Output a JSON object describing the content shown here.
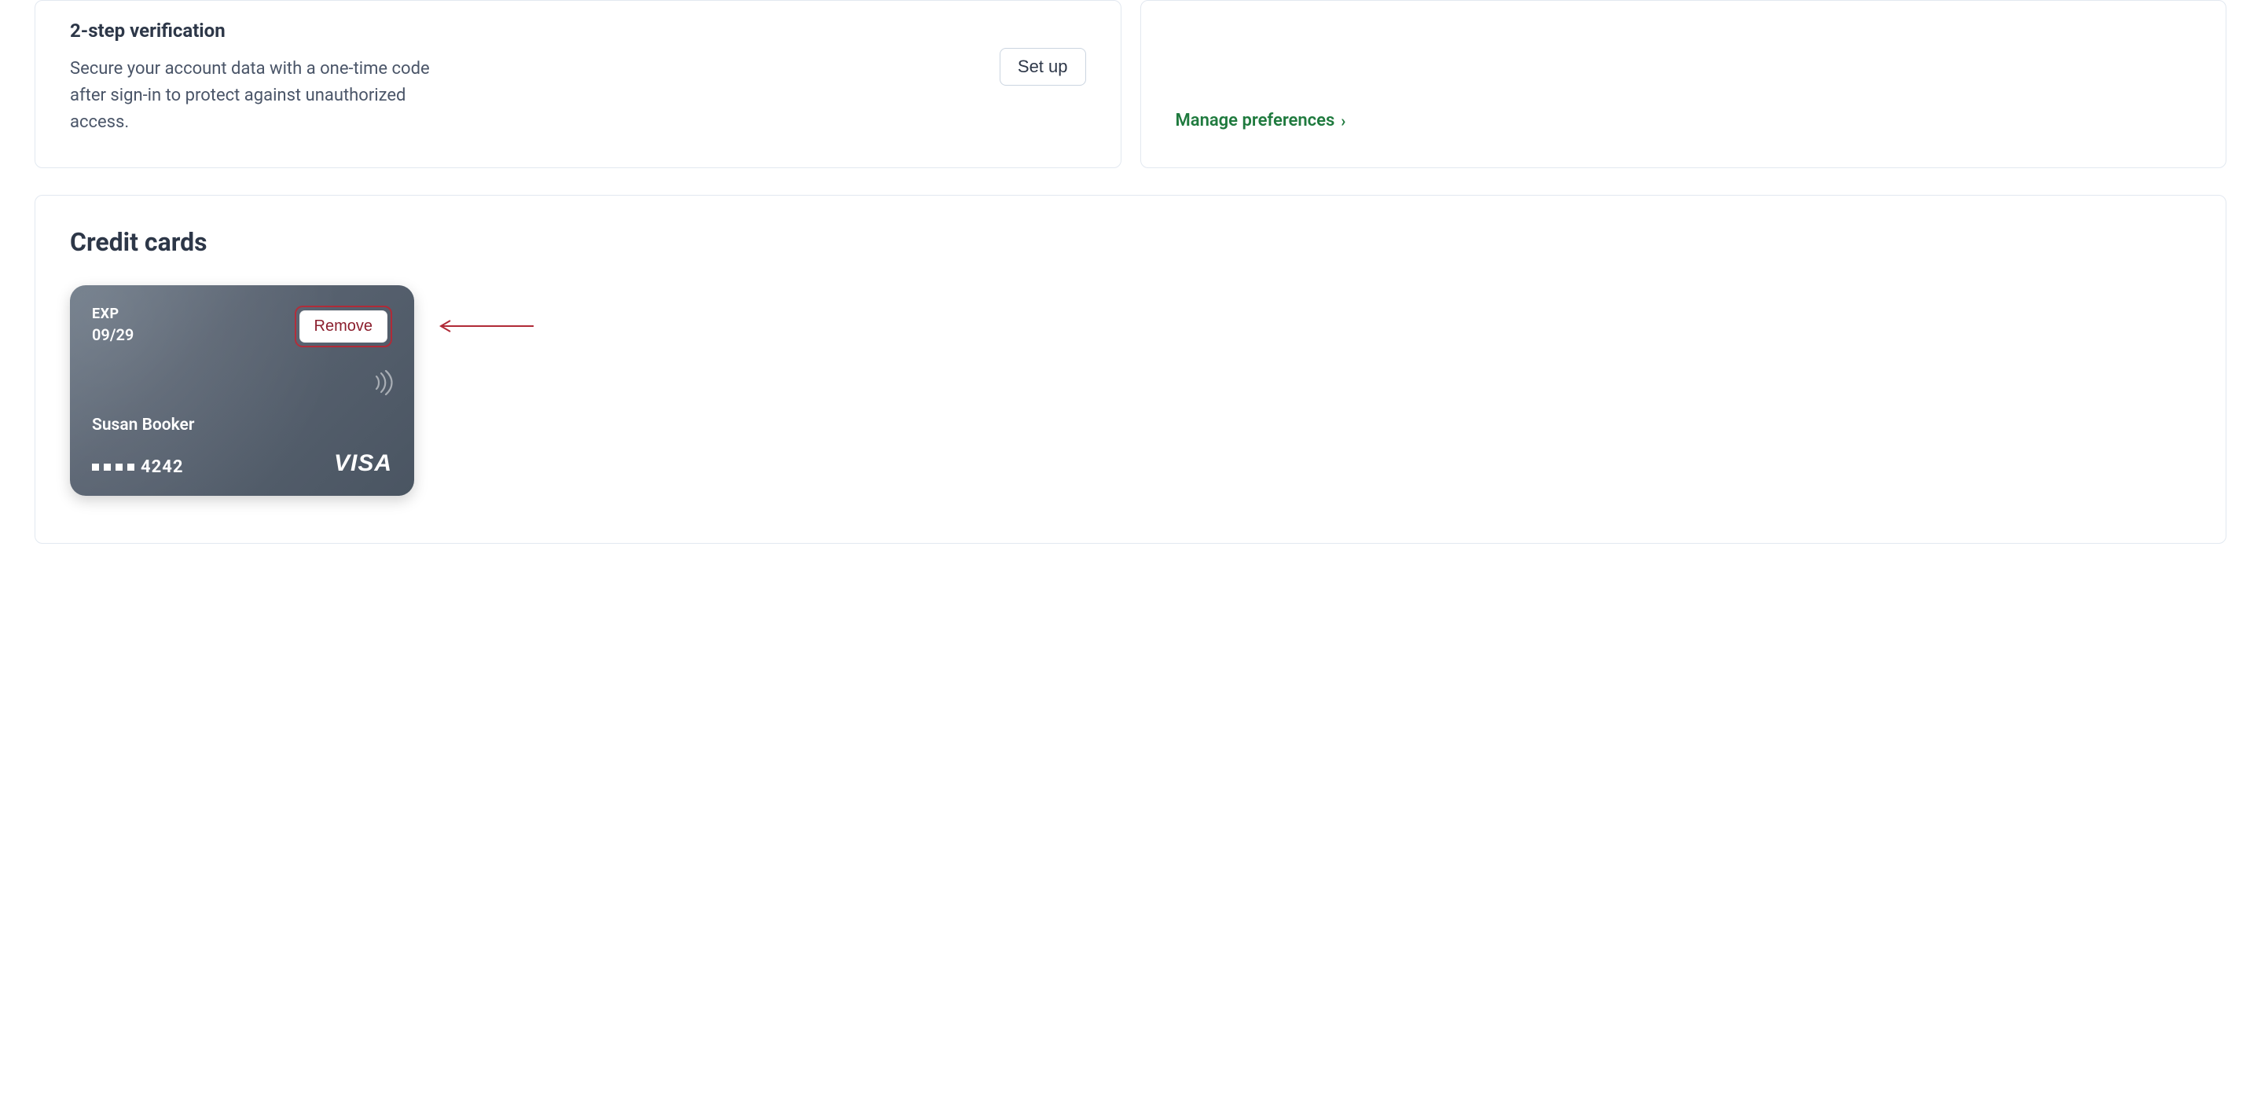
{
  "two_step": {
    "title": "2-step verification",
    "description": "Secure your account data with a one-time code after sign-in to protect against unauthorized access.",
    "button_label": "Set up"
  },
  "preferences": {
    "link_label": "Manage preferences"
  },
  "credit_cards": {
    "section_title": "Credit cards",
    "card": {
      "exp_label": "EXP",
      "exp_value": "09/29",
      "remove_label": "Remove",
      "cardholder": "Susan Booker",
      "last4": "4242",
      "brand": "VISA"
    }
  },
  "annotation": {
    "highlight_color": "#b02a37"
  }
}
